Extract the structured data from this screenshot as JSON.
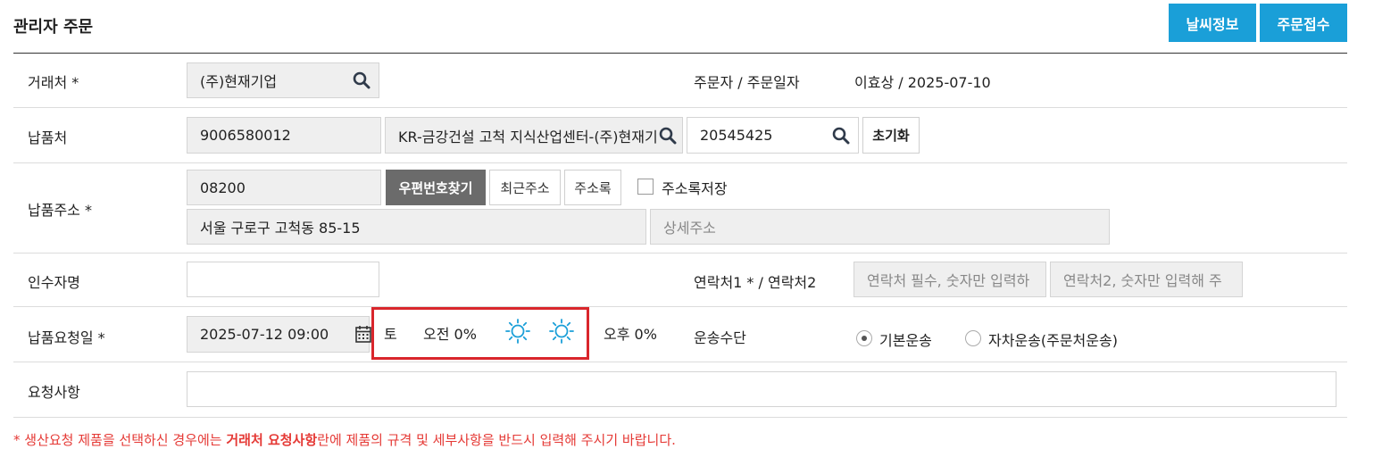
{
  "header": {
    "title": "관리자 주문",
    "weather_button": "날씨정보",
    "order_button": "주문접수"
  },
  "customer": {
    "label": "거래처 *",
    "value": "(주)현재기업",
    "orderer_label": "주문자 / 주문일자",
    "orderer_value": "이효상 / 2025-07-10"
  },
  "delivery_place": {
    "label": "납품처",
    "code": "9006580012",
    "name": "KR-금강건설 고척 지식산업센터-(주)현재기",
    "number": "20545425",
    "reset_button": "초기화"
  },
  "address": {
    "label": "납품주소 *",
    "zipcode": "08200",
    "find_zip_button": "우편번호찾기",
    "recent_button": "최근주소",
    "book_button": "주소록",
    "save_label": "주소록저장",
    "save_checked": false,
    "address1": "서울 구로구 고척동 85-15",
    "address2_placeholder": "상세주소"
  },
  "receiver": {
    "label": "인수자명",
    "value": "",
    "contact_label": "연락처1 * / 연락처2",
    "contact1_placeholder": "연락처 필수, 숫자만 입력하",
    "contact2_placeholder": "연락처2, 숫자만 입력해 주"
  },
  "request_date": {
    "label": "납품요청일 *",
    "value": "2025-07-12 09:00",
    "weekday": "토",
    "am_label": "오전 0%",
    "pm_label": "오후 0%",
    "am_weather_icon": "sun-icon",
    "pm_weather_icon": "sun-icon",
    "weather_color": "#1a9fd8"
  },
  "transport": {
    "label": "운송수단",
    "options": [
      "기본운송",
      "자차운송(주문처운송)"
    ],
    "selected": "기본운송"
  },
  "requests": {
    "label": "요청사항",
    "value": ""
  },
  "notice": {
    "prefix": "* 생산요청 제품을 선택하신 경우에는 ",
    "emphasis": "거래처 요청사항",
    "suffix": "란에 제품의 규격 및 세부사항을 반드시 입력해 주시기 바랍니다.",
    "color": "#e53935"
  }
}
